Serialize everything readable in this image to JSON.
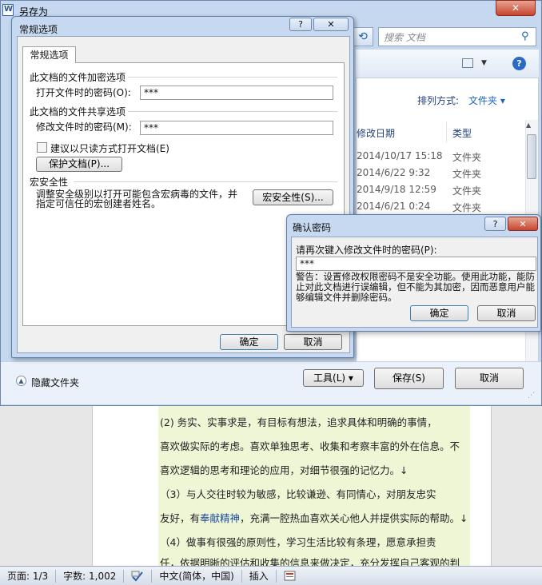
{
  "saveas": {
    "title": "另存为",
    "close_glyph": "✕",
    "search_placeholder": "搜索 文档",
    "sort_label": "排列方式:",
    "sort_value": "文件夹 ▾",
    "columns": {
      "date": "修改日期",
      "type": "类型"
    },
    "rows": [
      {
        "date": "2014/10/17 15:18",
        "type": "文件夹"
      },
      {
        "date": "2014/6/22 9:32",
        "type": "文件夹"
      },
      {
        "date": "2014/9/18 12:59",
        "type": "文件夹"
      },
      {
        "date": "2014/6/21 0:24",
        "type": "文件夹"
      }
    ],
    "hide_folders": "隐藏文件夹",
    "tools_label": "工具(L)",
    "save_label": "保存(S)",
    "cancel_label": "取消",
    "help_glyph": "?"
  },
  "general_options": {
    "title": "常规选项",
    "tab": "常规选项",
    "encrypt_section": "此文档的文件加密选项",
    "open_password_label": "打开文件时的密码(O):",
    "open_password_value": "***",
    "share_section": "此文档的文件共享选项",
    "modify_password_label": "修改文件时的密码(M):",
    "modify_password_value": "***",
    "readonly_recommend": "建议以只读方式打开文档(E)",
    "protect_button": "保护文档(P)...",
    "macro_section": "宏安全性",
    "macro_desc": "调整安全级别以打开可能包含宏病毒的文件，并指定可信任的宏创建者姓名。",
    "macro_button": "宏安全性(S)...",
    "ok": "确定",
    "cancel": "取消",
    "help_glyph": "?",
    "close_glyph": "✕"
  },
  "confirm_password": {
    "title": "确认密码",
    "prompt": "请再次键入修改文件时的密码(P):",
    "value": "***",
    "warning": "警告：设置修改权限密码不是安全功能。使用此功能，能防止对此文档进行误编辑，但不能为其加密，因而恶意用户能够编辑文件并删除密码。",
    "ok": "确定",
    "cancel": "取消",
    "help_glyph": "?",
    "close_glyph": "✕"
  },
  "document": {
    "lines": [
      "(2) 务实、实事求是，有目标有想法，追求具体和明确的事情，",
      "喜欢做实际的考虑。喜欢单独思考、收集和考察丰富的外在信息。不",
      "喜欢逻辑的思考和理论的应用，对细节很强的记忆力。↓",
      "（3）与人交往时较为敏感，比较谦逊、有同情心，对朋友忠实",
      "友好，有",
      "奉献精神",
      "，充满一腔热血喜欢关心他人并提供实际的帮助。↓",
      "（4）做事有很强的原则性，学习生活比较有条理，愿意承担责",
      "任，依据明晰的评估和收集的信息来做决定，充分发挥自己客观的判"
    ]
  },
  "statusbar": {
    "page": "页面: 1/3",
    "words": "字数: 1,002",
    "language": "中文(简体，中国)",
    "mode": "插入"
  }
}
